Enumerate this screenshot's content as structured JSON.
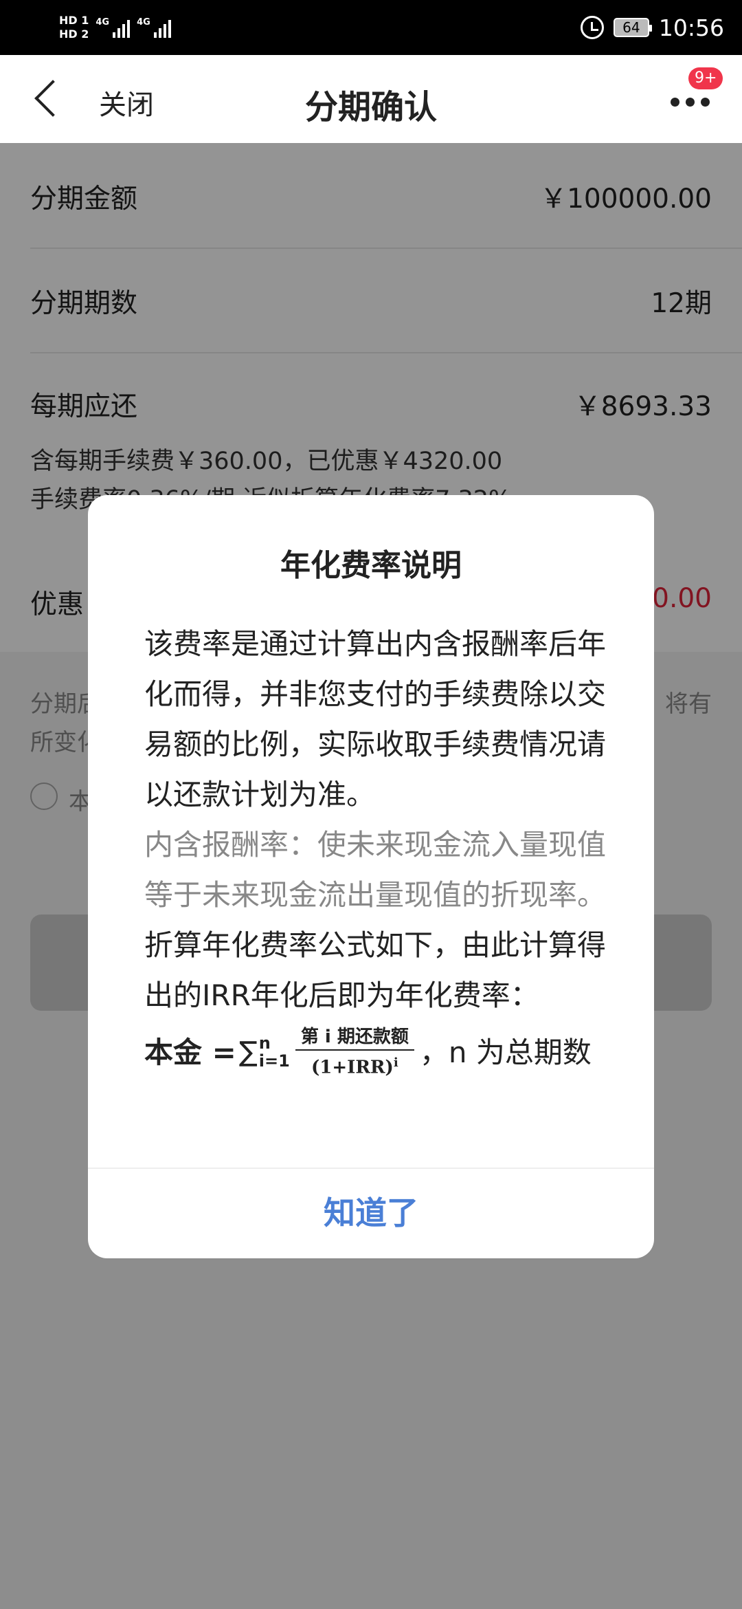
{
  "status_bar": {
    "hd1": "HD",
    "hd1_sub": "1",
    "hd2": "HD",
    "hd2_sub": "2",
    "net1": "4G",
    "net2": "4G",
    "battery": "64",
    "time": "10:56"
  },
  "nav": {
    "close": "关闭",
    "title": "分期确认",
    "badge": "9+"
  },
  "rows": {
    "amount_label": "分期金额",
    "amount_value": "￥100000.00",
    "periods_label": "分期期数",
    "periods_value": "12期",
    "each_label": "每期应还",
    "each_value": "￥8693.33",
    "fee_line": "含每期手续费￥360.00，已优惠￥4320.00",
    "rate_line": "手续费率0.36%/期 近似折算年化费率7.32%",
    "discount_label": "优惠",
    "discount_value": "0.00"
  },
  "notes": {
    "line1_left": "分期后",
    "line1_right": "将有",
    "line2": "所变化",
    "radio_label": "本"
  },
  "dialog": {
    "title": "年化费率说明",
    "para1": "该费率是通过计算出内含报酬率后年化而得，并非您支付的手续费除以交易额的比例，实际收取手续费情况请以还款计划为准。",
    "para2": "内含报酬率：使未来现金流入量现值等于未来现金流出量现值的折现率。",
    "para3": "折算年化费率公式如下，由此计算得出的IRR年化后即为年化费率：",
    "formula_lhs": "本金 =",
    "formula_sigma": "∑",
    "formula_upper": "n",
    "formula_lower": "i=1",
    "formula_num": "第 i 期还款额",
    "formula_den": "(1+IRR)",
    "formula_exp": "i",
    "formula_tail": "，n 为总期数",
    "button": "知道了"
  }
}
